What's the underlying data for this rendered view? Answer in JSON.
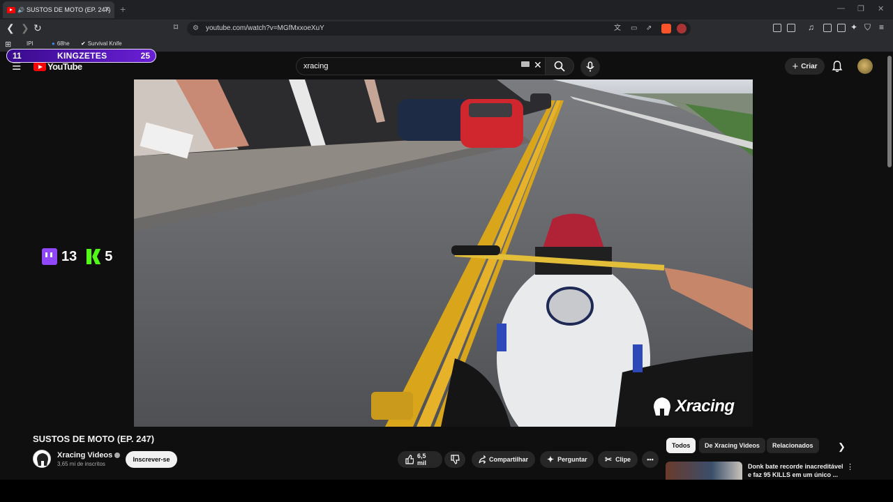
{
  "browser": {
    "tab_title": "SUSTOS DE MOTO (EP. 247)",
    "url": "youtube.com/watch?v=MGfMxxoeXuY",
    "bookmarks": [
      "IPI",
      "68he",
      "Survival Knife"
    ]
  },
  "youtube": {
    "logo_text": "YouTube",
    "search_value": "xracing",
    "create_label": "Criar"
  },
  "overlay": {
    "score_left": "11",
    "score_name": "KINGZETES",
    "score_right": "25",
    "twitch_count": "13",
    "kick_count": "5"
  },
  "video": {
    "watermark": "Xracing",
    "title": "SUSTOS DE MOTO (EP. 247)",
    "channel_name": "Xracing Videos",
    "subscribers": "3,65 mi de inscritos",
    "subscribe_label": "Inscrever-se",
    "likes": "6,5 mil",
    "share_label": "Compartilhar",
    "ask_label": "Perguntar",
    "clip_label": "Clipe"
  },
  "recommendations": {
    "chips": [
      "Todos",
      "De Xracing Videos",
      "Relacionados"
    ],
    "first_title": "Donk bate recorde inacreditável e faz 95 KILLS em um único ..."
  },
  "colors": {
    "brand_red": "#ff0000",
    "score_purple": "#6a1fd6",
    "twitch": "#9146ff",
    "kick": "#53fc18"
  }
}
